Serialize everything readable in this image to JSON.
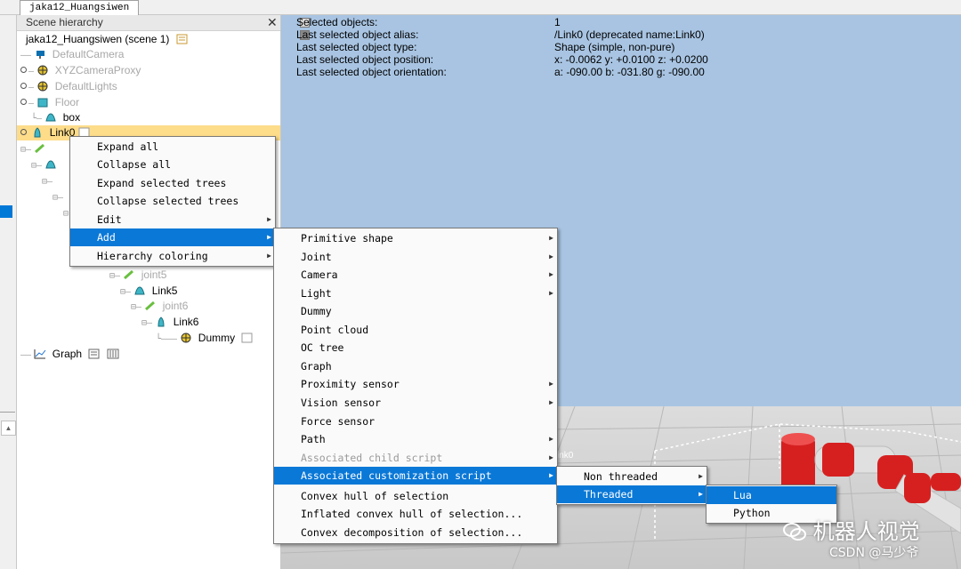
{
  "window": {
    "tab_label": "jaka12_Huangsiwen"
  },
  "hierarchy": {
    "title": "Scene hierarchy",
    "close_glyph": "✕",
    "scene_root": "jaka12_Huangsiwen (scene 1)",
    "items": [
      {
        "label": "DefaultCamera",
        "icon": "camera-icon"
      },
      {
        "label": "XYZCameraProxy",
        "icon": "dummy-icon"
      },
      {
        "label": "DefaultLights",
        "icon": "light-icon"
      },
      {
        "label": "Floor",
        "icon": "shape-icon"
      },
      {
        "label": "box",
        "icon": "shape-icon"
      },
      {
        "label": "Link0",
        "icon": "shape-icon",
        "selected": true
      },
      {
        "label": "joint5",
        "icon": "joint-icon"
      },
      {
        "label": "Link5",
        "icon": "shape-icon"
      },
      {
        "label": "joint6",
        "icon": "joint-icon"
      },
      {
        "label": "Link6",
        "icon": "shape-icon"
      },
      {
        "label": "Dummy",
        "icon": "dummy-icon"
      },
      {
        "label": "Graph",
        "icon": "graph-icon"
      }
    ]
  },
  "viewport": {
    "info": [
      {
        "label": "Selected objects:",
        "value": "1"
      },
      {
        "label": "Last selected object alias:",
        "value": "/Link0    (deprecated name:Link0)"
      },
      {
        "label": "Last selected object type:",
        "value": "Shape (simple, non-pure)"
      },
      {
        "label": "Last selected object position:",
        "value": "x: -0.0062    y: +0.0100    z: +0.0200"
      },
      {
        "label": "Last selected object orientation:",
        "value": "a: -090.00    b: -031.80    g: -090.00"
      }
    ],
    "floor_label": "ink0"
  },
  "context_menu": {
    "items": [
      {
        "label": "Expand all",
        "submenu": false
      },
      {
        "label": "Collapse all",
        "submenu": false
      },
      {
        "label": "Expand selected trees",
        "submenu": false
      },
      {
        "label": "Collapse selected trees",
        "submenu": false
      },
      {
        "label": "Edit",
        "submenu": true
      },
      {
        "label": "Add",
        "submenu": true,
        "active": true
      },
      {
        "label": "Hierarchy coloring",
        "submenu": true
      }
    ]
  },
  "add_menu": {
    "items": [
      {
        "label": "Primitive shape",
        "submenu": true
      },
      {
        "label": "Joint",
        "submenu": true
      },
      {
        "label": "Camera",
        "submenu": true
      },
      {
        "label": "Light",
        "submenu": true
      },
      {
        "label": "Dummy",
        "submenu": false
      },
      {
        "label": "Point cloud",
        "submenu": false
      },
      {
        "label": "OC tree",
        "submenu": false
      },
      {
        "label": "Graph",
        "submenu": false
      },
      {
        "label": "Proximity sensor",
        "submenu": true
      },
      {
        "label": "Vision sensor",
        "submenu": true
      },
      {
        "label": "Force sensor",
        "submenu": false
      },
      {
        "label": "Path",
        "submenu": true
      },
      {
        "label": "Associated child script",
        "submenu": true,
        "disabled": true
      },
      {
        "label": "Associated customization script",
        "submenu": true,
        "active": true
      },
      {
        "label": "Convex hull of selection",
        "submenu": false
      },
      {
        "label": "Inflated convex hull of selection...",
        "submenu": false
      },
      {
        "label": "Convex decomposition of selection...",
        "submenu": false
      }
    ]
  },
  "script_menu": {
    "items": [
      {
        "label": "Non threaded",
        "submenu": true
      },
      {
        "label": "Threaded",
        "submenu": true,
        "active": true
      }
    ]
  },
  "lang_menu": {
    "items": [
      {
        "label": "Lua",
        "active": true
      },
      {
        "label": "Python"
      }
    ]
  },
  "watermark": {
    "channel": "机器人视觉",
    "credit": "CSDN @马少爷"
  },
  "colors": {
    "accent": "#0a78d7",
    "selection": "#fddc8a",
    "viewport_bg": "#a8c4e2",
    "robot_red": "#d62020"
  }
}
